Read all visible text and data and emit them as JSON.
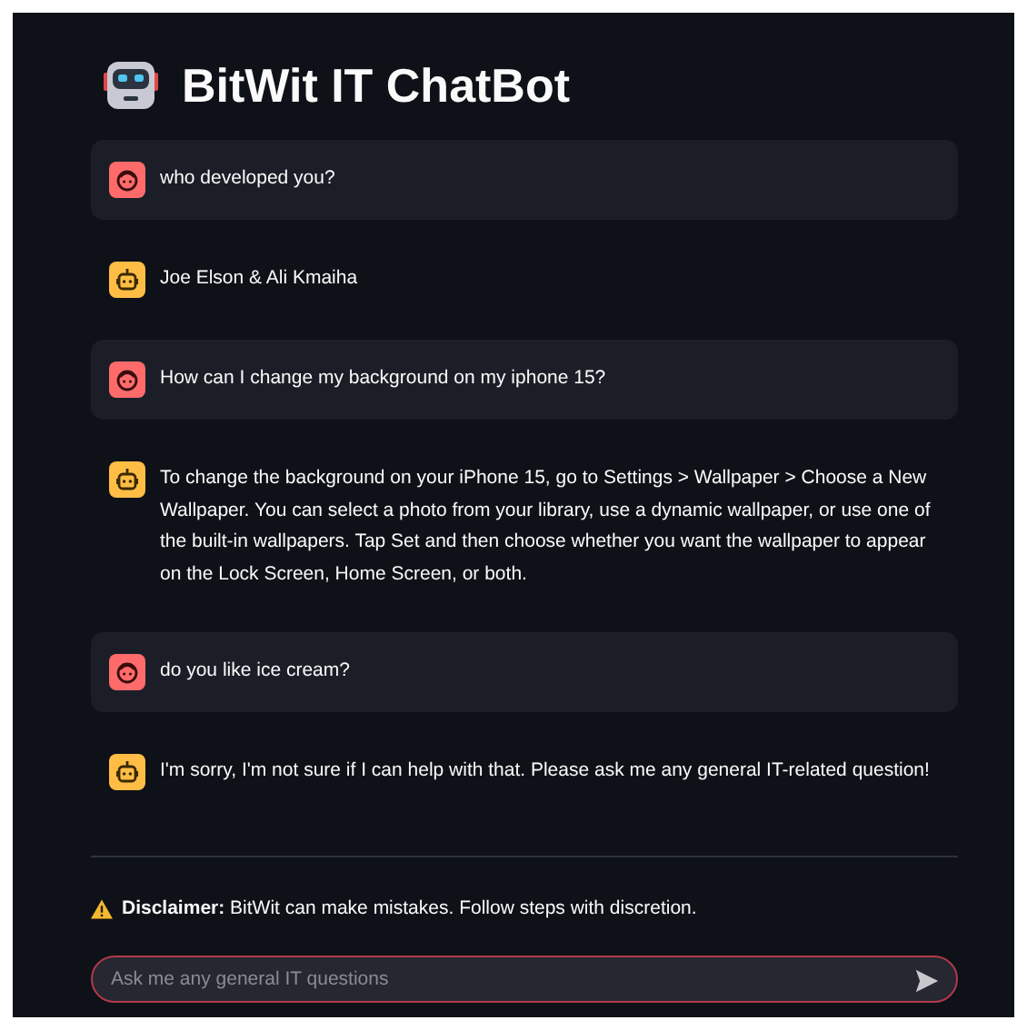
{
  "title": "BitWit IT ChatBot",
  "messages": [
    {
      "kind": "user",
      "text": "who developed you?"
    },
    {
      "kind": "assistant",
      "text": "Joe Elson & Ali Kmaiha"
    },
    {
      "kind": "user",
      "text": "How can I change my background on my iphone 15?"
    },
    {
      "kind": "assistant",
      "text": "To change the background on your iPhone 15, go to Settings > Wallpaper > Choose a New Wallpaper. You can select a photo from your library, use a dynamic wallpaper, or use one of the built-in wallpapers. Tap Set and then choose whether you want the wallpaper to appear on the Lock Screen, Home Screen, or both."
    },
    {
      "kind": "user",
      "text": "do you like ice cream?"
    },
    {
      "kind": "assistant",
      "text": "I'm sorry, I'm not sure if I can help with that. Please ask me any general IT-related question!"
    }
  ],
  "disclaimer": "**Disclaimer:** BitWit can make mistakes. Follow steps with discretion.",
  "input": {
    "placeholder": "Ask me any general IT questions"
  }
}
